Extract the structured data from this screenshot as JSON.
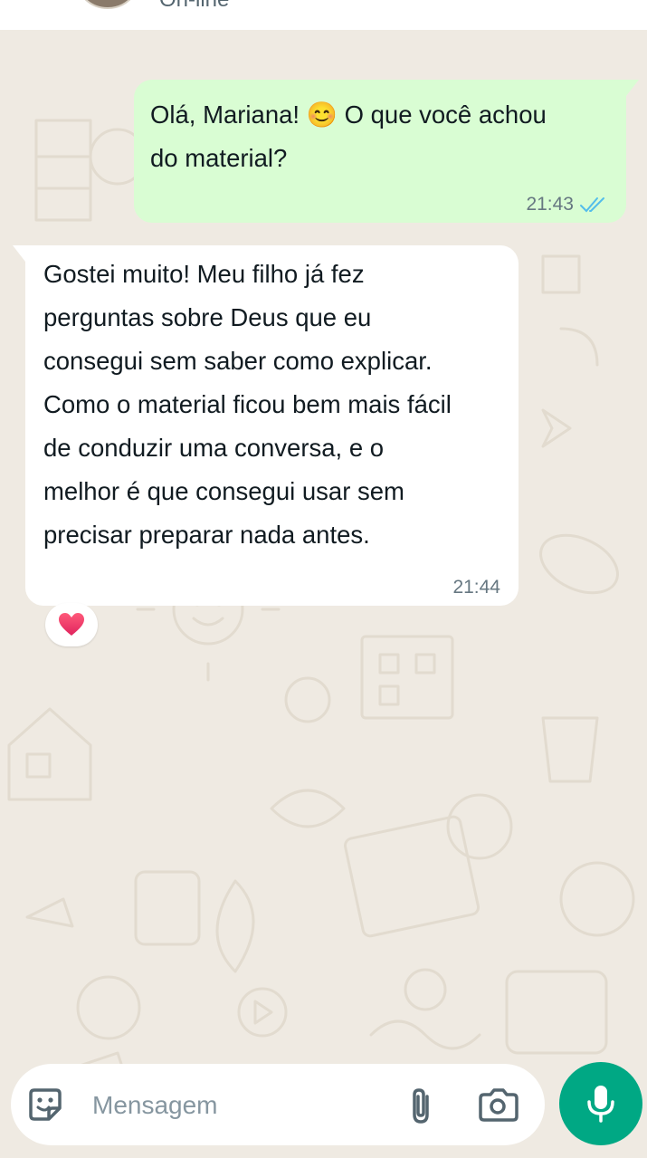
{
  "header": {
    "status": "On-line"
  },
  "messages": [
    {
      "direction": "outgoing",
      "lines": [
        "Olá, Mariana! 😊 O que você achou",
        "do material?"
      ],
      "time": "21:43",
      "read": true
    },
    {
      "direction": "incoming",
      "lines": [
        "Gostei muito! Meu filho já fez",
        "perguntas sobre Deus que eu",
        "consegui sem saber como explicar.",
        "Como o material ficou bem mais fácil",
        "de conduzir uma conversa, e o",
        "melhor é que consegui usar sem",
        "precisar preparar nada antes."
      ],
      "time": "21:44",
      "reaction": "heart"
    }
  ],
  "composer": {
    "placeholder": "Mensagem",
    "icons": [
      "sticker-icon",
      "attach-icon",
      "camera-icon",
      "mic-icon"
    ]
  },
  "colors": {
    "outgoing_bubble": "#d9fdd3",
    "incoming_bubble": "#ffffff",
    "background": "#efeae2",
    "accent": "#00a884",
    "read_ticks": "#53bdeb"
  }
}
